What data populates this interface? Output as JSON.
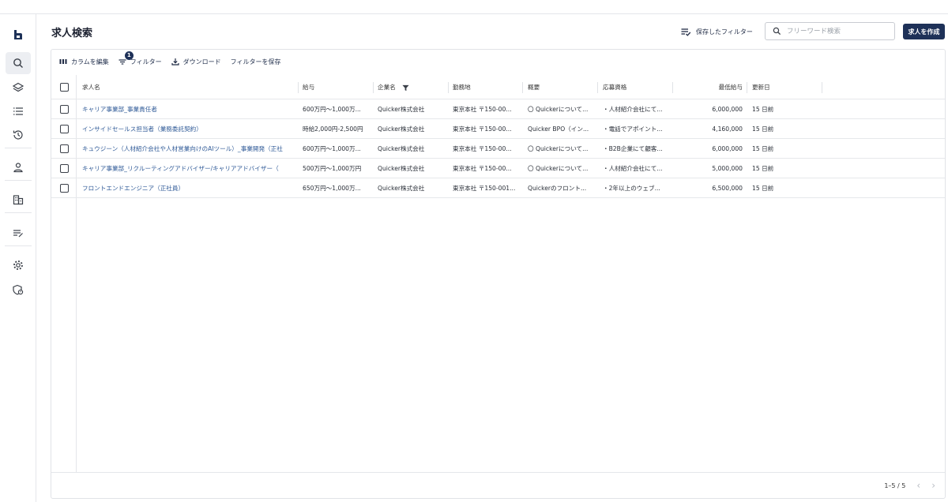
{
  "header": {
    "title": "求人検索",
    "saved_filter_label": "保存したフィルター",
    "search_placeholder": "フリーワード検索",
    "create_label": "求人を作成"
  },
  "sidebar": {
    "items": [
      {
        "name": "logo",
        "icon": "brand-logo"
      },
      {
        "name": "search",
        "icon": "search-icon",
        "active": true
      },
      {
        "name": "layers",
        "icon": "layers-icon"
      },
      {
        "name": "list",
        "icon": "list-icon"
      },
      {
        "name": "history",
        "icon": "history-icon"
      },
      {
        "name": "person",
        "icon": "person-icon"
      },
      {
        "name": "company",
        "icon": "building-icon"
      },
      {
        "name": "tasks",
        "icon": "edit-list-icon"
      },
      {
        "name": "settings",
        "icon": "gear-icon"
      },
      {
        "name": "security",
        "icon": "shield-icon"
      }
    ]
  },
  "toolbar": {
    "edit_columns": "カラムを編集",
    "filter": "フィルター",
    "filter_count": "1",
    "download": "ダウンロード",
    "save_filter": "フィルターを保存"
  },
  "table": {
    "columns": [
      "求人名",
      "給与",
      "企業名",
      "勤務地",
      "概要",
      "応募資格",
      "最低給与",
      "更新日"
    ],
    "rows": [
      {
        "name": "キャリア事業部_事業責任者",
        "salary": "600万円〜1,000万...",
        "company": "Quicker株式会社",
        "location": "東京本社 〒150-00...",
        "summary": "〇 Quickerについて...",
        "requirements": "・人材紹介会社にて...",
        "min_salary": "6,000,000",
        "updated": "15 日前"
      },
      {
        "name": "インサイドセールス担当者（業務委託契約）",
        "salary": "時給2,000円-2,500円",
        "company": "Quicker株式会社",
        "location": "東京本社 〒150-00...",
        "summary": "Quicker BPO（イン...",
        "requirements": "・電話でアポイント...",
        "min_salary": "4,160,000",
        "updated": "15 日前"
      },
      {
        "name": "キュウジーン（人材紹介会社や人材営業向けのAIツール）_事業開発（正社",
        "salary": "600万円〜1,000万...",
        "company": "Quicker株式会社",
        "location": "東京本社 〒150-00...",
        "summary": "〇 Quickerについて...",
        "requirements": "・B2B企業にて顧客...",
        "min_salary": "6,000,000",
        "updated": "15 日前"
      },
      {
        "name": "キャリア事業部_リクルーティングアドバイザー/キャリアアドバイザー（",
        "salary": "500万円〜1,000万円",
        "company": "Quicker株式会社",
        "location": "東京本社 〒150-00...",
        "summary": "〇 Quickerについて...",
        "requirements": "・人材紹介会社にて...",
        "min_salary": "5,000,000",
        "updated": "15 日前"
      },
      {
        "name": "フロントエンドエンジニア（正社員）",
        "salary": "650万円〜1,000万...",
        "company": "Quicker株式会社",
        "location": "東京本社 〒150-001...",
        "summary": "Quickerのフロント...",
        "requirements": "・2年以上のウェブ...",
        "min_salary": "6,500,000",
        "updated": "15 日前"
      }
    ]
  },
  "pagination": {
    "range": "1–5 / 5"
  }
}
